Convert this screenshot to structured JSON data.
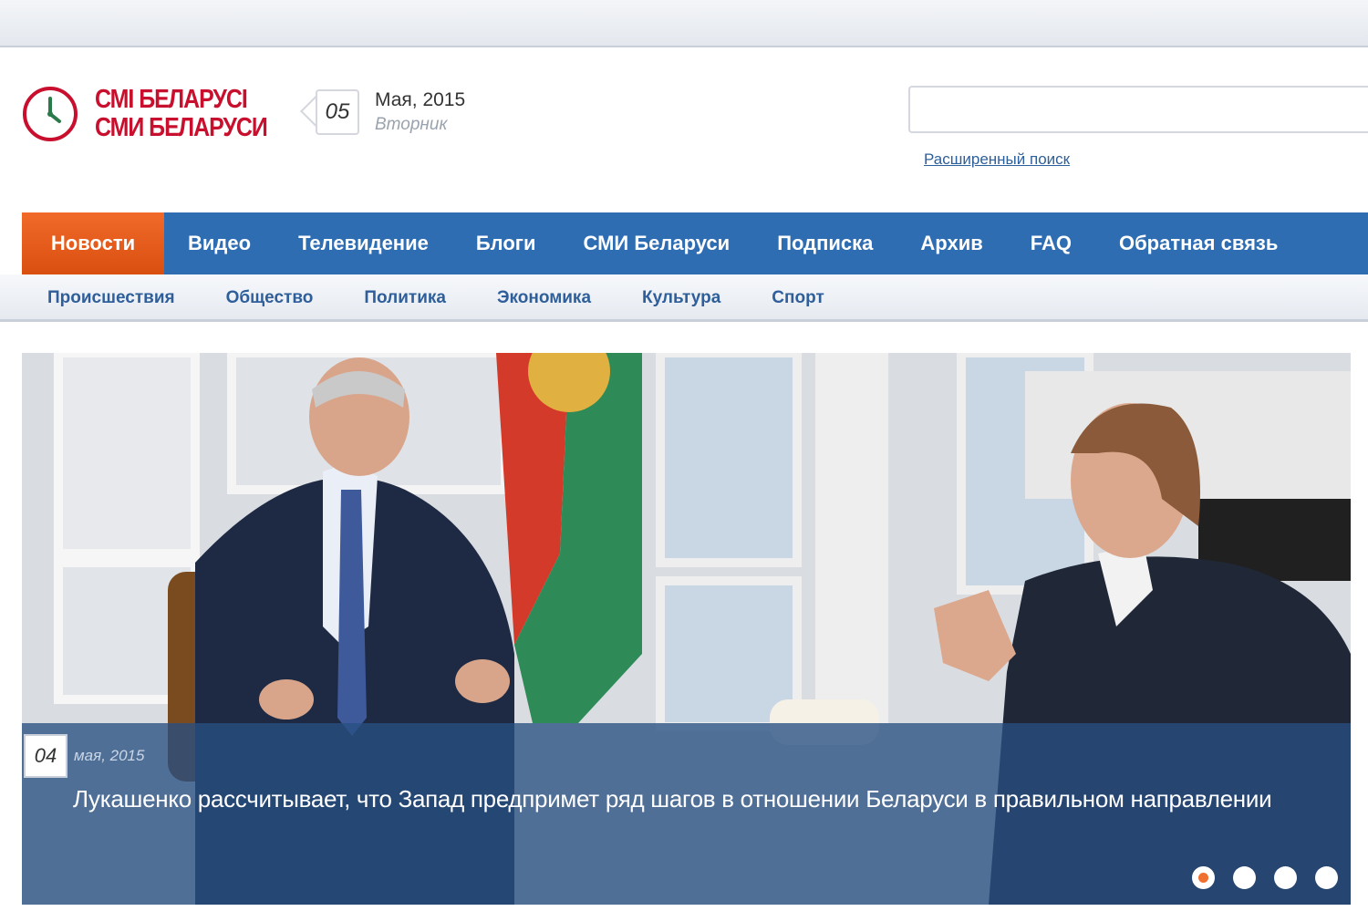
{
  "logo": {
    "line1": "СМІ БЕЛАРУСІ",
    "line2": "СМИ БЕЛАРУСИ",
    "brand_color": "#c8102e"
  },
  "date": {
    "day": "05",
    "month_year": "Мая, 2015",
    "weekday": "Вторник"
  },
  "search": {
    "value": "",
    "advanced_label": "Расширенный поиск"
  },
  "nav": {
    "items": [
      "Новости",
      "Видео",
      "Телевидение",
      "Блоги",
      "СМИ Беларуси",
      "Подписка",
      "Архив",
      "FAQ",
      "Обратная связь"
    ],
    "active": "Новости",
    "bg_color": "#2f6db3",
    "active_color": "#e85a1c"
  },
  "subnav": {
    "items": [
      "Происшествия",
      "Общество",
      "Политика",
      "Экономика",
      "Культура",
      "Спорт"
    ]
  },
  "slider": {
    "day": "04",
    "date": "мая, 2015",
    "title": "Лукашенко рассчитывает, что Запад предпримет ряд шагов в отношении Беларуси в правильном направлении",
    "dots_total": 4,
    "active_dot": 1
  }
}
